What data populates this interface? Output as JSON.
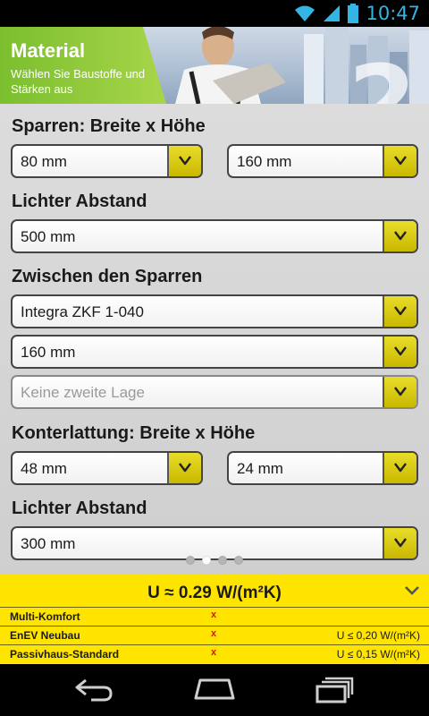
{
  "status_bar": {
    "time": "10:47",
    "icons": [
      "wifi-icon",
      "signal-icon",
      "battery-icon"
    ]
  },
  "header": {
    "title": "Material",
    "subtitle": "Wählen Sie Baustoffe und Stärken aus",
    "step": "2",
    "accent_color": "#8cc63f"
  },
  "sections": {
    "sparren": {
      "label": "Sparren: Breite x Höhe",
      "width_value": "80 mm",
      "height_value": "160 mm"
    },
    "lichter_abstand_1": {
      "label": "Lichter Abstand",
      "value": "500 mm"
    },
    "zwischen": {
      "label": "Zwischen den Sparren",
      "material": "Integra ZKF 1-040",
      "thickness": "160 mm",
      "second_layer_placeholder": "Keine zweite Lage"
    },
    "konterlattung": {
      "label": "Konterlattung: Breite x Höhe",
      "width_value": "48 mm",
      "height_value": "24 mm"
    },
    "lichter_abstand_2": {
      "label": "Lichter Abstand",
      "value": "300 mm"
    }
  },
  "pager": {
    "pages": 4,
    "active": 1
  },
  "result": {
    "u_value": "U ≈ 0.29 W/(m²K)",
    "rows": [
      {
        "name": "Multi-Komfort",
        "mark": "x",
        "requirement": ""
      },
      {
        "name": "EnEV Neubau",
        "mark": "x",
        "requirement": "U ≤ 0,20 W/(m²K)"
      },
      {
        "name": "Passivhaus-Standard",
        "mark": "x",
        "requirement": "U ≤ 0,15 W/(m²K)"
      }
    ],
    "panel_color": "#ffe400"
  },
  "nav": {
    "buttons": [
      "back-icon",
      "home-icon",
      "recent-apps-icon"
    ]
  }
}
